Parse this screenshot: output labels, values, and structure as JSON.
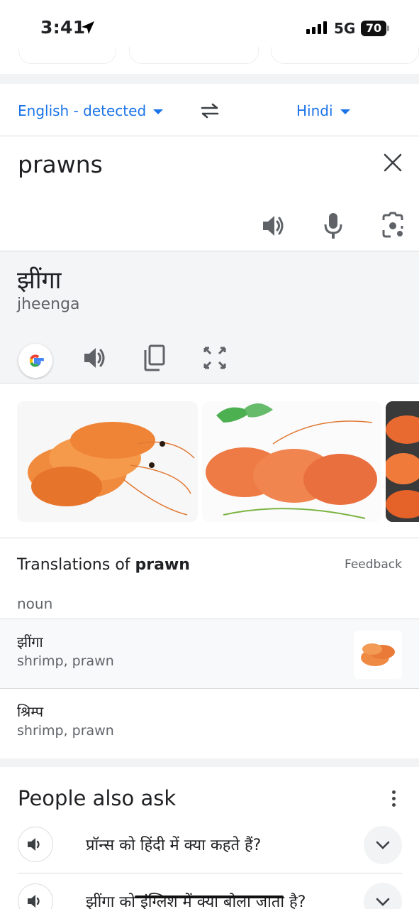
{
  "status_bar": {
    "time": "3:41",
    "network": "5G",
    "battery": "70"
  },
  "language_bar": {
    "source_lang": "English - detected",
    "target_lang": "Hindi"
  },
  "input": {
    "text": "prawns"
  },
  "result": {
    "text": "झींगा",
    "transliteration": "jheenga"
  },
  "images": {
    "alt": [
      "prawns photo 1",
      "prawns photo 2",
      "prawns photo 3"
    ]
  },
  "translations": {
    "title_prefix": "Translations of ",
    "title_word": "prawn",
    "feedback": "Feedback",
    "part_of_speech": "noun",
    "rows": [
      {
        "word": "झींगा",
        "synonyms": "shrimp, prawn"
      },
      {
        "word": "श्रिम्प",
        "synonyms": "shrimp, prawn"
      }
    ]
  },
  "people_also_ask": {
    "title": "People also ask",
    "questions": [
      "प्रॉन्स को हिंदी में क्या कहते हैं?",
      "झींगा को इंग्लिश में क्या बोला जाता है?"
    ]
  },
  "icons": [
    "location-arrow-icon",
    "signal-icon",
    "battery-icon",
    "caret-down-icon",
    "swap-icon",
    "close-icon",
    "speaker-icon",
    "mic-icon",
    "camera-lens-icon",
    "google-icon",
    "copy-icon",
    "fullscreen-icon",
    "more-vert-icon",
    "chevron-down-icon"
  ],
  "colors": {
    "accent": "#1a73e8",
    "result_bg": "#f4f5f6",
    "divider": "#dadce0"
  }
}
